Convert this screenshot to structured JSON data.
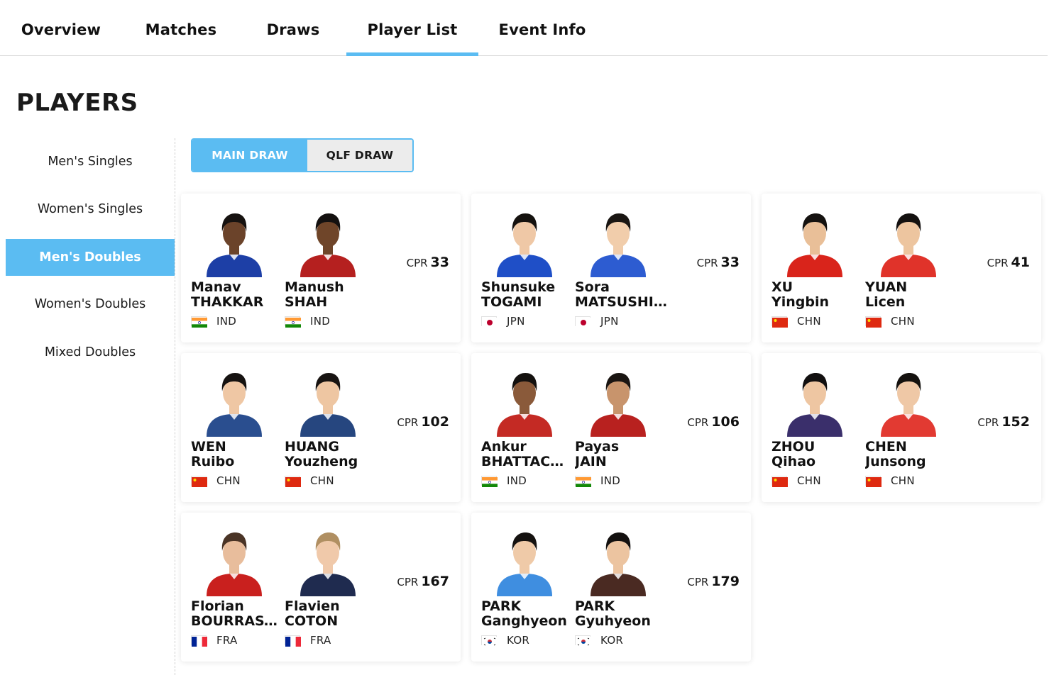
{
  "tabs": [
    {
      "label": "Overview",
      "active": false
    },
    {
      "label": "Matches",
      "active": false
    },
    {
      "label": "Draws",
      "active": false
    },
    {
      "label": "Player List",
      "active": true
    },
    {
      "label": "Event Info",
      "active": false
    }
  ],
  "page_title": "PLAYERS",
  "sidebar": {
    "items": [
      {
        "label": "Men's Singles",
        "active": false
      },
      {
        "label": "Women's Singles",
        "active": false
      },
      {
        "label": "Men's Doubles",
        "active": true
      },
      {
        "label": "Women's Doubles",
        "active": false
      },
      {
        "label": "Mixed Doubles",
        "active": false
      }
    ]
  },
  "draw_toggle": {
    "main": "MAIN DRAW",
    "qualifying": "QLF DRAW",
    "selected": "MAIN DRAW"
  },
  "colors": {
    "accent": "#5bbcf2"
  },
  "cpr_label": "CPR",
  "pairs": [
    {
      "cpr": "33",
      "players": [
        {
          "first": "Manav",
          "last": "THAKKAR",
          "country": "IND",
          "shirt": "#1d3fa6",
          "skin": "#6b432a",
          "hair": "#161210",
          "flag": "ind"
        },
        {
          "first": "Manush",
          "last": "SHAH",
          "country": "IND",
          "shirt": "#b5201f",
          "skin": "#6f4529",
          "hair": "#141110",
          "flag": "ind"
        }
      ]
    },
    {
      "cpr": "33",
      "players": [
        {
          "first": "Shunsuke",
          "last": "TOGAMI",
          "country": "JPN",
          "shirt": "#1f4fc7",
          "skin": "#efc8a6",
          "hair": "#15120f",
          "flag": "jpn"
        },
        {
          "first": "Sora",
          "last": "MATSUSHIMA",
          "country": "JPN",
          "shirt": "#2d5cd1",
          "skin": "#f1cdab",
          "hair": "#1a1613",
          "flag": "jpn"
        }
      ]
    },
    {
      "cpr": "41",
      "players": [
        {
          "first": "XU",
          "last": "Yingbin",
          "country": "CHN",
          "shirt": "#d9241b",
          "skin": "#e9bf98",
          "hair": "#151210",
          "flag": "chn"
        },
        {
          "first": "YUAN",
          "last": "Licen",
          "country": "CHN",
          "shirt": "#e0332a",
          "skin": "#edc59f",
          "hair": "#141110",
          "flag": "chn"
        }
      ]
    },
    {
      "cpr": "102",
      "players": [
        {
          "first": "WEN",
          "last": "Ruibo",
          "country": "CHN",
          "shirt": "#2a4e8f",
          "skin": "#efc7a4",
          "hair": "#161311",
          "flag": "chn"
        },
        {
          "first": "HUANG",
          "last": "Youzheng",
          "country": "CHN",
          "shirt": "#26467f",
          "skin": "#eec6a2",
          "hair": "#181412",
          "flag": "chn"
        }
      ]
    },
    {
      "cpr": "106",
      "players": [
        {
          "first": "Ankur",
          "last": "BHATTACHARJEE",
          "country": "IND",
          "shirt": "#c42a24",
          "skin": "#8a5a3a",
          "hair": "#14110f",
          "flag": "ind"
        },
        {
          "first": "Payas",
          "last": "JAIN",
          "country": "IND",
          "shirt": "#b8211f",
          "skin": "#c8946c",
          "hair": "#1a1512",
          "flag": "ind"
        }
      ]
    },
    {
      "cpr": "152",
      "players": [
        {
          "first": "ZHOU",
          "last": "Qihao",
          "country": "CHN",
          "shirt": "#3a2f6b",
          "skin": "#eec6a2",
          "hair": "#121010",
          "flag": "chn"
        },
        {
          "first": "CHEN",
          "last": "Junsong",
          "country": "CHN",
          "shirt": "#e23a32",
          "skin": "#efc8a6",
          "hair": "#15120f",
          "flag": "chn"
        }
      ]
    },
    {
      "cpr": "167",
      "players": [
        {
          "first": "Florian",
          "last": "BOURRASSAUD",
          "country": "FRA",
          "shirt": "#c9201e",
          "skin": "#e8bd9c",
          "hair": "#4a3426",
          "flag": "fra"
        },
        {
          "first": "Flavien",
          "last": "COTON",
          "country": "FRA",
          "shirt": "#1f2b4f",
          "skin": "#f0c9aa",
          "hair": "#b08f62",
          "flag": "fra"
        }
      ]
    },
    {
      "cpr": "179",
      "players": [
        {
          "first": "PARK",
          "last": "Ganghyeon",
          "country": "KOR",
          "shirt": "#3f8ee0",
          "skin": "#efcaa8",
          "hair": "#151210",
          "flag": "kor"
        },
        {
          "first": "PARK",
          "last": "Gyuhyeon",
          "country": "KOR",
          "shirt": "#4a2a22",
          "skin": "#ecc4a0",
          "hair": "#141110",
          "flag": "kor"
        }
      ]
    }
  ]
}
